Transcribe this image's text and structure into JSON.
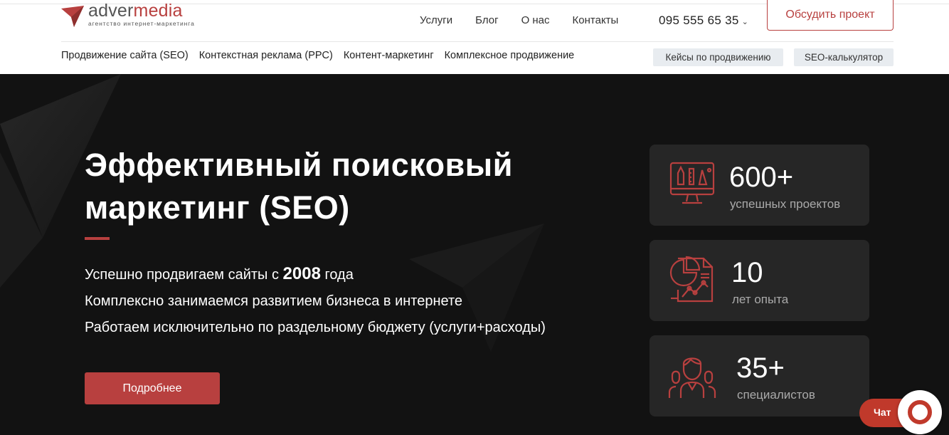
{
  "logo": {
    "brand_pre": "adver",
    "brand_post": "media",
    "tagline": "агентство интернет-маркетинга",
    "icon": "paper-plane-icon"
  },
  "nav": {
    "items": [
      "Услуги",
      "Блог",
      "О нас",
      "Контакты"
    ],
    "phone": "095 555 65 35",
    "phone_icon": "chevron-down-icon",
    "cta": "Обсудить проект"
  },
  "subnav": {
    "items": [
      "Продвижение сайта (SEO)",
      "Контекстная реклама (PPC)",
      "Контент-маркетинг",
      "Комплексное продвижение"
    ],
    "chips": [
      "Кейсы по продвижению",
      "SEO-калькулятор"
    ]
  },
  "hero": {
    "title": "Эффективный поисковый маркетинг (SEO)",
    "line1_pre": "Успешно продвигаем сайты с ",
    "line1_year": "2008",
    "line1_post": " года",
    "line2": "Комплексно занимаемся развитием бизнеса в интернете",
    "line3": "Работаем исключительно по раздельному бюджету (услуги+расходы)",
    "button": "Подробнее"
  },
  "stats": [
    {
      "number": "600+",
      "label": "успешных проектов",
      "icon": "design-monitor-icon"
    },
    {
      "number": "10",
      "label": "лет опыта",
      "icon": "report-chart-icon"
    },
    {
      "number": "35+",
      "label": "специалистов",
      "icon": "team-icon"
    }
  ],
  "chat": {
    "label": "Чат",
    "icon": "chat-ring-icon"
  },
  "colors": {
    "accent": "#b8403f",
    "hero_bg": "#141414",
    "card_bg": "#262626",
    "chip_bg": "#e8ecf0"
  }
}
